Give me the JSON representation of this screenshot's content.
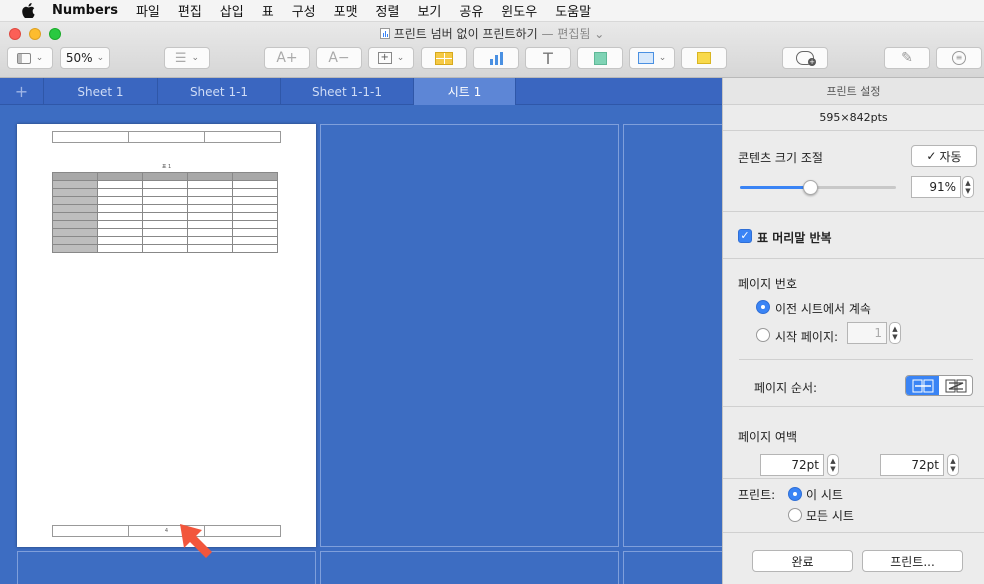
{
  "menubar": {
    "app_name": "Numbers",
    "items": [
      "파일",
      "편집",
      "삽입",
      "표",
      "구성",
      "포맷",
      "정렬",
      "보기",
      "공유",
      "윈도우",
      "도움말"
    ]
  },
  "window": {
    "title": "프린트 넘버 없이 프린트하기",
    "status": "— 편집됨"
  },
  "toolbar": {
    "zoom": "50%"
  },
  "tabs": [
    "Sheet 1",
    "Sheet 1-1",
    "Sheet 1-1-1",
    "시트 1"
  ],
  "page": {
    "table_title": "표 1",
    "footer_page": "4"
  },
  "print_settings": {
    "header": "프린트 설정",
    "paper_size": "595×842pts",
    "content_scale_label": "콘텐츠 크기 조절",
    "auto_label": "자동",
    "scale_value": "91%",
    "scale_fraction": 0.45,
    "repeat_header_label": "표 머리말 반복",
    "page_number_label": "페이지 번호",
    "continue_label": "이전 시트에서 계속",
    "start_page_label": "시작 페이지:",
    "start_page_value": "1",
    "page_order_label": "페이지 순서:",
    "margins_label": "페이지 여백",
    "margin_left": "72pt",
    "margin_right": "72pt",
    "print_label": "프린트:",
    "this_sheet_label": "이 시트",
    "all_sheets_label": "모든 시트",
    "done_button": "완료",
    "print_button": "프린트..."
  },
  "colors": {
    "accent": "#3a84f5",
    "canvas": "#3d6dc2",
    "arrow": "#f2563c"
  }
}
